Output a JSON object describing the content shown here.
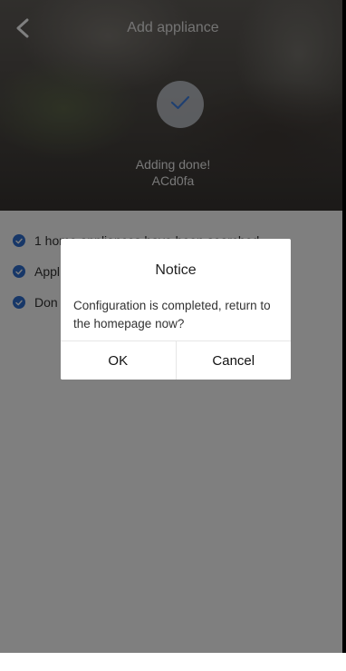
{
  "header": {
    "title": "Add appliance",
    "status_line1": "Adding done!",
    "status_line2": "ACd0fa",
    "back_icon": "chevron-left-icon",
    "check_icon": "checkmark-icon"
  },
  "status": {
    "items": [
      {
        "label": "1 home appliances have been searched"
      },
      {
        "label": "Appl"
      },
      {
        "label": "Don"
      }
    ],
    "accent": "#2f6fd1"
  },
  "dialog": {
    "title": "Notice",
    "message": "Configuration is completed, return to the homepage now?",
    "ok_label": "OK",
    "cancel_label": "Cancel"
  }
}
